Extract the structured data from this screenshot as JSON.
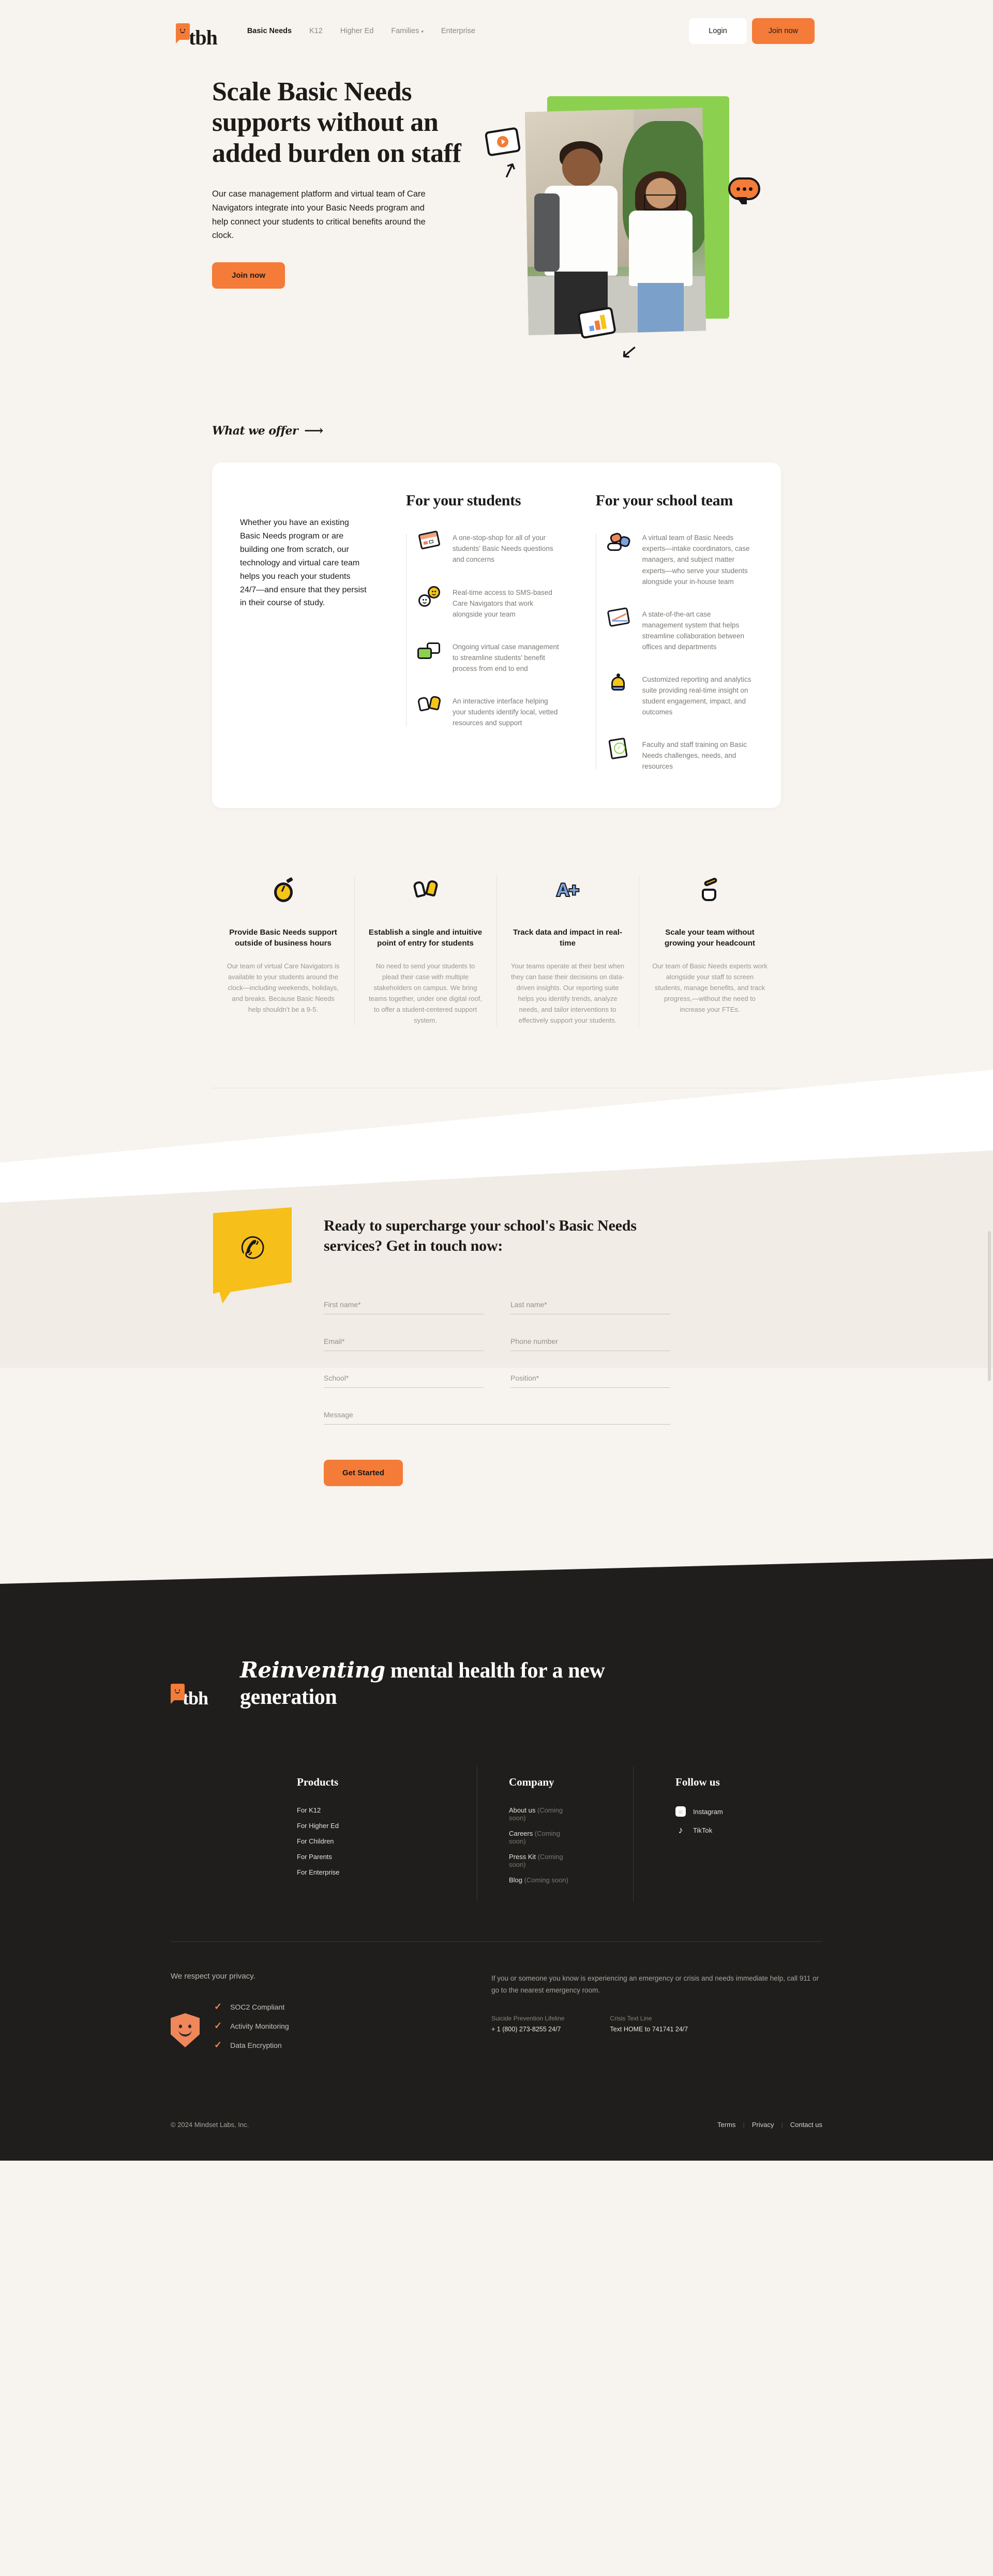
{
  "nav": {
    "brand": "tbh",
    "brand_icon": "smiley-speech-bubble-icon",
    "links": [
      {
        "label": "Basic Needs",
        "active": true,
        "caret": false
      },
      {
        "label": "K12",
        "active": false,
        "caret": false
      },
      {
        "label": "Higher Ed",
        "active": false,
        "caret": false
      },
      {
        "label": "Families",
        "active": false,
        "caret": true
      },
      {
        "label": "Enterprise",
        "active": false,
        "caret": false
      }
    ],
    "caret_glyph": "▾",
    "login_label": "Login",
    "join_label": "Join now"
  },
  "hero": {
    "heading": "Scale Basic Needs supports without an added burden on staff",
    "subheading": "Our case management platform and virtual team of Care Navigators integrate into your Basic Needs program and help connect your students to critical benefits around the clock.",
    "cta_label": "Join now",
    "stickers": [
      "video-play-sticker",
      "bar-chart-sticker",
      "chat-bubble-sticker"
    ],
    "arrows": [
      "curved-arrow-up",
      "curved-arrow-left"
    ]
  },
  "offer": {
    "eyebrow": "What we offer",
    "eyebrow_arrow": "⟶",
    "intro": "Whether you have an existing Basic Needs program or are building one from scratch, our technology and virtual care team helps you reach your students 24/7—and ensure that they persist in their course of study.",
    "students": {
      "title": "For your students",
      "items": [
        {
          "icon": "calendar-icon",
          "text": "A one-stop-shop for all of your students’ Basic Needs questions and concerns"
        },
        {
          "icon": "smileys-icon",
          "text": "Real-time access to SMS-based Care Navigators that work alongside your team"
        },
        {
          "icon": "chat-windows-icon",
          "text": "Ongoing virtual case management to streamline students’ benefit process from end to end"
        },
        {
          "icon": "high-five-hands-icon",
          "text": "An interactive interface helping your students identify local, vetted resources and support"
        }
      ]
    },
    "team": {
      "title": "For your school team",
      "items": [
        {
          "icon": "handshake-icon",
          "text": "A virtual team of Basic Needs experts—intake coordinators, case managers, and subject matter experts—who serve your students alongside your in-house team"
        },
        {
          "icon": "line-graph-icon",
          "text": "A state-of-the-art case management system that helps streamline collaboration between offices and departments"
        },
        {
          "icon": "bell-icon",
          "text": "Customized reporting and analytics suite providing real-time insight on student engagement, impact, and outcomes"
        },
        {
          "icon": "checklist-icon",
          "text": "Faculty and staff training on Basic Needs challenges, needs, and resources"
        }
      ]
    }
  },
  "features": [
    {
      "icon": "stopwatch-icon",
      "title": "Provide Basic Needs support outside of business hours",
      "desc": "Our team of virtual Care Navigators is available to your students around the clock—including weekends, holidays, and breaks. Because Basic Needs help shouldn’t be a 9-5."
    },
    {
      "icon": "waving-hands-icon",
      "title": "Establish a single and intuitive point of entry for students",
      "desc": "No need to send your students to plead their case with multiple stakeholders on campus. We bring teams together, under one digital roof, to offer a student-centered support system."
    },
    {
      "icon": "a-plus-icon",
      "title": "Track data and impact in real-time",
      "desc": "Your teams operate at their best when they can base their decisions on data-driven insights. Our reporting suite helps you identify trends, analyze needs, and tailor interventions to effectively support your students."
    },
    {
      "icon": "raised-hand-icon",
      "title": "Scale your team without growing your headcount",
      "desc": "Our team of Basic Needs experts work alongside your staff to screen students, manage benefits, and track progress,—without the need to increase your FTEs."
    }
  ],
  "contact": {
    "badge_icon": "phone-icon",
    "heading": "Ready to supercharge your school's Basic Needs services? Get in touch now:",
    "fields": {
      "first_name": "First name*",
      "last_name": "Last name*",
      "email": "Email*",
      "phone": "Phone number",
      "school": "School*",
      "position": "Position*",
      "message": "Message"
    },
    "submit_label": "Get Started"
  },
  "footer": {
    "brand": "tbh",
    "tagline_script": "Reinventing",
    "tagline_rest": " mental health for a new generation",
    "columns": {
      "products": {
        "title": "Products",
        "links": [
          "For K12",
          "For Higher Ed",
          "For Children",
          "For Parents",
          "For Enterprise"
        ]
      },
      "company": {
        "title": "Company",
        "links": [
          {
            "label": "About us",
            "note": "(Coming soon)"
          },
          {
            "label": "Careers",
            "note": "(Coming soon)"
          },
          {
            "label": "Press Kit",
            "note": "(Coming soon)"
          },
          {
            "label": "Blog",
            "note": "(Coming soon)"
          }
        ]
      },
      "follow": {
        "title": "Follow us",
        "links": [
          {
            "label": "Instagram",
            "icon": "instagram-icon"
          },
          {
            "label": "TikTok",
            "icon": "tiktok-icon"
          }
        ]
      }
    },
    "privacy": {
      "heading": "We respect your privacy.",
      "badge_icon": "smiley-shield-icon",
      "items": [
        "SOC2 Compliant",
        "Activity Monitoring",
        "Data Encryption"
      ],
      "check_glyph": "✓"
    },
    "emergency": {
      "text": "If you or someone you know is experiencing an emergency or crisis and needs immediate help, call 911 or go to the nearest emergency room.",
      "lines": [
        {
          "label": "Suicide Prevention Lifeline",
          "value": "+ 1 (800) 273-8255 24/7"
        },
        {
          "label": "Crisis Text Line",
          "value": "Text HOME to 741741 24/7"
        }
      ]
    },
    "copyright": "© 2024 Mindset Labs, Inc.",
    "legal": [
      "Terms",
      "Privacy",
      "Contact us"
    ],
    "legal_divider": "|"
  },
  "colors": {
    "background": "#f7f3ee",
    "accent_orange": "#f47b38",
    "accent_yellow": "#f7bf1a",
    "accent_green": "#8bd14f",
    "ink": "#1c1b19",
    "footer_bg": "#1f1e1c"
  }
}
